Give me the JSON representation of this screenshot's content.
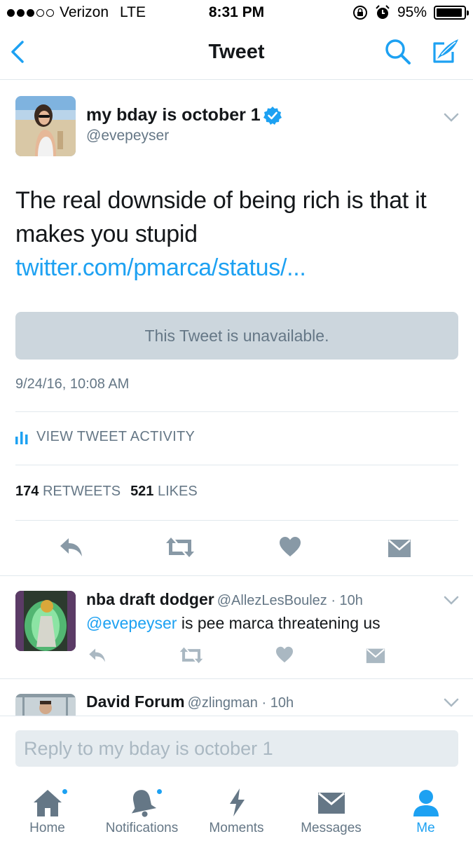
{
  "status_bar": {
    "carrier": "Verizon",
    "network": "LTE",
    "time": "8:31 PM",
    "battery": "95%",
    "battery_level": 0.95
  },
  "nav": {
    "title": "Tweet",
    "icons": [
      "back-icon",
      "search-icon",
      "compose-icon"
    ]
  },
  "tweet": {
    "author_name": "my bday is october 1",
    "author_handle": "@evepeyser",
    "text_plain": "The real downside of being rich is that it makes you stupid ",
    "link": "twitter.com/pmarca/status/...",
    "quote_unavailable": "This Tweet is unavailable.",
    "timestamp": "9/24/16, 10:08 AM",
    "activity_label": "VIEW TWEET ACTIVITY",
    "retweet_count": "174",
    "retweet_label": "RETWEETS",
    "like_count": "521",
    "like_label": "LIKES"
  },
  "replies": [
    {
      "name": "nba draft dodger",
      "handle": "@AllezLesBoulez · 10h",
      "mention": "@evepeyser",
      "text": " is pee marca threatening us"
    },
    {
      "name": "David Forum",
      "handle": "@zlingman · 10h"
    }
  ],
  "composer": {
    "placeholder": "Reply to my bday is october 1"
  },
  "tabs": [
    {
      "label": "Home",
      "icon": "home-icon",
      "badge": true
    },
    {
      "label": "Notifications",
      "icon": "bell-icon",
      "badge": true
    },
    {
      "label": "Moments",
      "icon": "lightning-icon",
      "badge": false
    },
    {
      "label": "Messages",
      "icon": "envelope-icon",
      "badge": false
    },
    {
      "label": "Me",
      "icon": "person-icon",
      "badge": false,
      "active": true
    }
  ],
  "colors": {
    "accent": "#1da1f2",
    "text": "#14171a",
    "secondary": "#657786",
    "icon_gray": "#8899a6",
    "divider": "#e1e8ed"
  }
}
